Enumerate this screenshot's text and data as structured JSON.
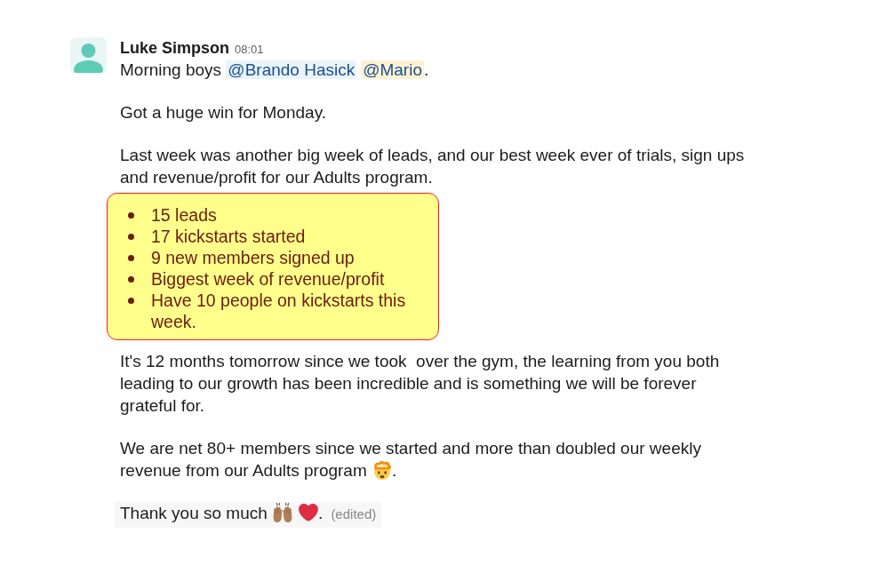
{
  "message": {
    "author": "Luke Simpson",
    "time": "08:01",
    "blocks": [
      {
        "kind": "paragraph",
        "highlighted": false,
        "segments": [
          {
            "kind": "text",
            "text": "Morning boys "
          },
          {
            "kind": "mention",
            "text": "@Brando Hasick",
            "highlighted": false
          },
          {
            "kind": "mention",
            "text": "@Mario",
            "highlighted": true
          },
          {
            "kind": "text",
            "text": "."
          }
        ]
      },
      {
        "kind": "paragraph",
        "highlighted": false,
        "segments": [
          {
            "kind": "text",
            "text": "Got a huge win for Monday."
          }
        ]
      },
      {
        "kind": "paragraph",
        "highlighted": false,
        "segments": [
          {
            "kind": "text",
            "text": "Last week was another big week of leads, and our best week ever of trials, sign ups\nand revenue/profit for our Adults program."
          }
        ]
      },
      {
        "kind": "list",
        "items": [
          "15 leads",
          "17 kickstarts started",
          "9 new members signed up",
          "Biggest week of revenue/profit",
          "Have 10 people on kickstarts this\nweek."
        ]
      },
      {
        "kind": "paragraph",
        "highlighted": false,
        "segments": [
          {
            "kind": "text",
            "text": "It's 12 months tomorrow since we took  over the gym, the learning from you both\nleading to our growth has been incredible and is something we will be forever\ngrateful for."
          }
        ]
      },
      {
        "kind": "paragraph",
        "highlighted": false,
        "segments": [
          {
            "kind": "text",
            "text": "We are net 80+ members since we started and more than doubled our weekly\nrevenue from our Adults program "
          },
          {
            "kind": "icon"
          },
          {
            "kind": "text",
            "text": "."
          }
        ]
      },
      {
        "kind": "paragraph",
        "highlighted": true,
        "segments": [
          {
            "kind": "text",
            "text": "Thank you so much "
          },
          {
            "kind": "icon"
          },
          {
            "kind": "icon"
          },
          {
            "kind": "text",
            "text": "."
          },
          {
            "kind": "edited",
            "text": "(edited)"
          }
        ]
      }
    ]
  }
}
